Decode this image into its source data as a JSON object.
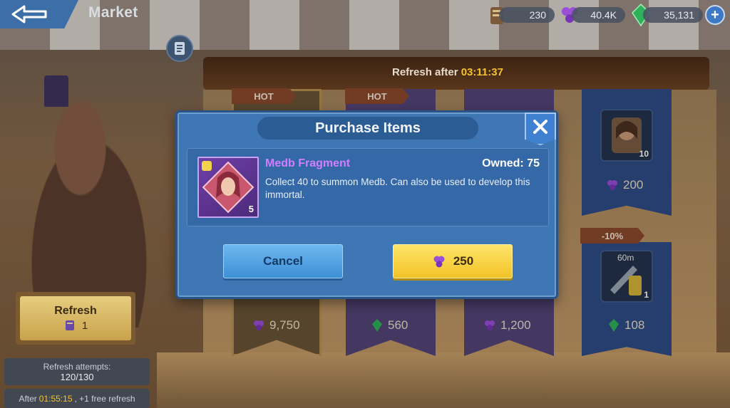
{
  "header": {
    "title": "Market",
    "currencies": [
      {
        "name": "scroll-currency",
        "value": "230"
      },
      {
        "name": "grape-currency",
        "value": "40.4K"
      },
      {
        "name": "gem-currency",
        "value": "35,131"
      }
    ]
  },
  "shop": {
    "refresh_label": "Refresh after",
    "refresh_timer": "03:11:37",
    "tags": [
      "HOT",
      "HOT",
      "-10%"
    ],
    "prices": [
      "9,750",
      "560",
      "1,200",
      "108",
      "200"
    ],
    "slot_counts": [
      "10",
      "1"
    ],
    "slot_timer": "60m"
  },
  "left_panel": {
    "refresh_button": "Refresh",
    "refresh_cost": "1",
    "attempts_label": "Refresh attempts:",
    "attempts_value": "120/130",
    "free_prefix": "After",
    "free_timer": "01:55:15",
    "free_suffix": ", +1 free refresh"
  },
  "modal": {
    "title": "Purchase Items",
    "item_name": "Medb Fragment",
    "item_quantity": "5",
    "owned": "Owned: 75",
    "description": "Collect 40 to summon Medb. Can also be used to develop this immortal.",
    "cancel_label": "Cancel",
    "buy_price": "250"
  },
  "colors": {
    "modal_bg": "#3f76b4",
    "item_name": "#d37dff",
    "buy_button": "#f2c328",
    "cancel_button": "#4f9fe0",
    "timer": "#f2c230"
  }
}
